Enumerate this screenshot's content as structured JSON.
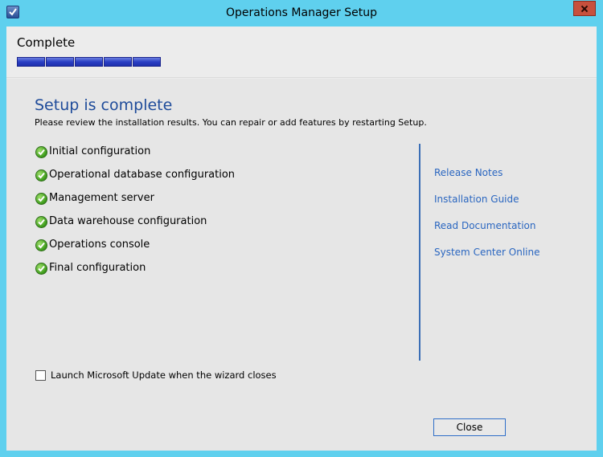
{
  "window": {
    "title": "Operations Manager Setup",
    "app_icon": "setup-check-icon",
    "close_icon": "close-icon"
  },
  "header": {
    "page_title": "Complete",
    "progress": {
      "completed_steps": 5,
      "total_steps": 5,
      "color": "#2a3fc4"
    }
  },
  "main": {
    "heading": "Setup is complete",
    "subtext": "Please review the installation results.  You can repair or add features by restarting Setup.",
    "results": [
      {
        "label": "Initial configuration",
        "status": "success"
      },
      {
        "label": "Operational database configuration",
        "status": "success"
      },
      {
        "label": "Management server",
        "status": "success"
      },
      {
        "label": "Data warehouse configuration",
        "status": "success"
      },
      {
        "label": "Operations console",
        "status": "success"
      },
      {
        "label": "Final configuration",
        "status": "success"
      }
    ],
    "status_icon": "green-check-icon"
  },
  "links": [
    "Release Notes",
    "Installation Guide",
    "Read Documentation",
    "System Center Online"
  ],
  "footer": {
    "checkbox_label": "Launch Microsoft Update when the wizard closes",
    "checkbox_checked": false,
    "close_button": "Close"
  },
  "colors": {
    "heading": "#1e4b9a",
    "link": "#2a66c0",
    "titlebar": "#5fd0ee",
    "success": "#3b9a1a"
  }
}
